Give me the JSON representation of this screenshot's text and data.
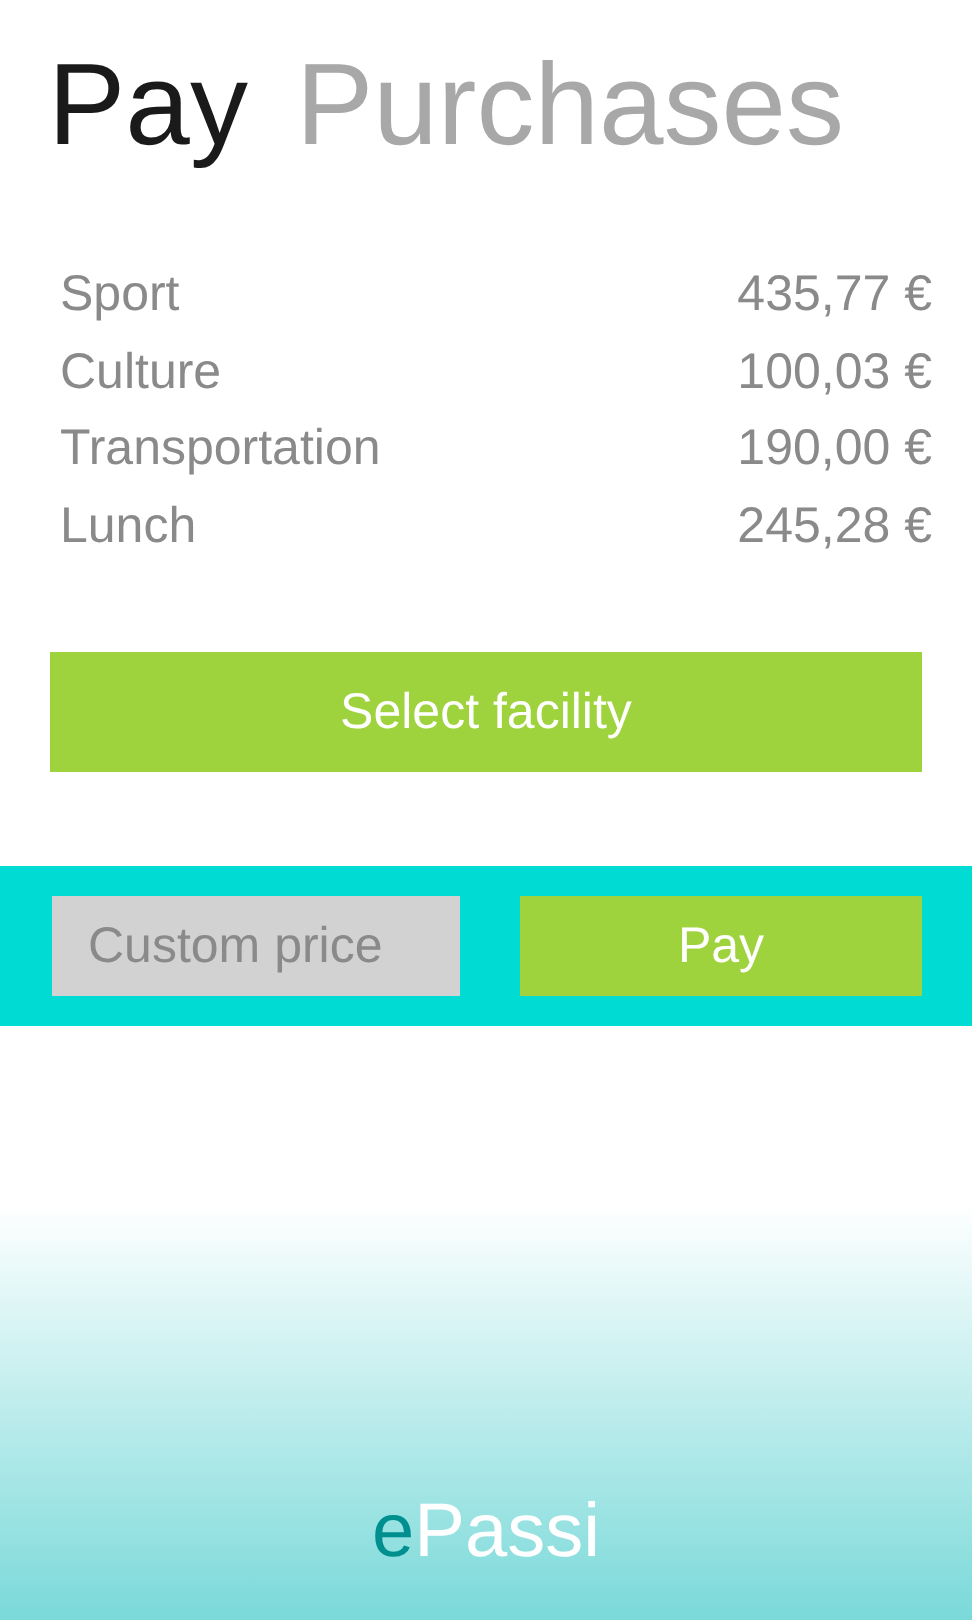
{
  "tabs": [
    {
      "label": "Pay",
      "selected": true
    },
    {
      "label": "Purchases",
      "selected": false
    }
  ],
  "balances": [
    {
      "name": "Sport",
      "amount": "435,77 €"
    },
    {
      "name": "Culture",
      "amount": "100,03 €"
    },
    {
      "name": "Transportation",
      "amount": "190,00 €"
    },
    {
      "name": "Lunch",
      "amount": "245,28 €"
    }
  ],
  "select_button": "Select facility",
  "custom_price": {
    "placeholder": "Custom price"
  },
  "pay_button": "Pay",
  "logo": {
    "prefix": "e",
    "rest": "Passi"
  }
}
